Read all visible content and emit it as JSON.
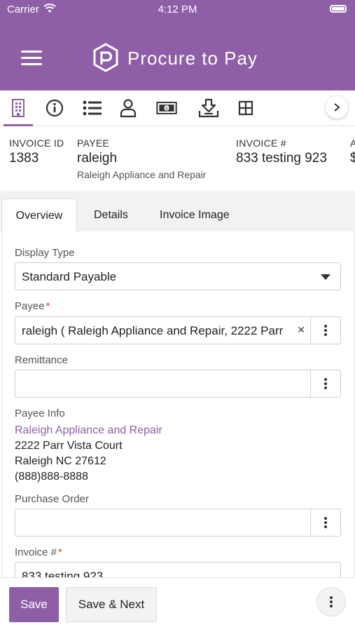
{
  "status_bar": {
    "carrier": "Carrier",
    "time": "4:12 PM"
  },
  "app": {
    "title": "Procure to Pay",
    "accent_color": "#8e5fa6"
  },
  "icon_toolbar": {
    "icons": [
      "building-icon",
      "info-icon",
      "list-icon",
      "user-icon",
      "money-icon",
      "download-tray-icon",
      "grid-icon"
    ],
    "active": "building-icon"
  },
  "summary": {
    "invoice_id_label": "INVOICE ID",
    "invoice_id": "1383",
    "payee_label": "PAYEE",
    "payee_name": "raleigh",
    "payee_company": "Raleigh Appliance and Repair",
    "invoice_num_label": "INVOICE #",
    "invoice_num": "833 testing 923",
    "cut_label": "A",
    "cut_value": "$"
  },
  "tabs": [
    {
      "label": "Overview",
      "active": true
    },
    {
      "label": "Details",
      "active": false
    },
    {
      "label": "Invoice Image",
      "active": false
    }
  ],
  "form": {
    "display_type_label": "Display Type",
    "display_type_value": "Standard Payable",
    "payee_label": "Payee",
    "payee_value": "raleigh ( Raleigh Appliance and Repair, 2222 Parr",
    "remittance_label": "Remittance",
    "remittance_value": "",
    "payee_info_label": "Payee Info",
    "payee_info": {
      "name": "Raleigh Appliance and Repair",
      "address1": "2222 Parr Vista Court",
      "address2": "Raleigh NC 27612",
      "phone": "(888)888-8888"
    },
    "purchase_order_label": "Purchase Order",
    "purchase_order_value": "",
    "invoice_num_label": "Invoice #",
    "invoice_num_value": "833 testing 923",
    "required_mark": "*"
  },
  "footer": {
    "save_label": "Save",
    "save_next_label": "Save & Next"
  }
}
